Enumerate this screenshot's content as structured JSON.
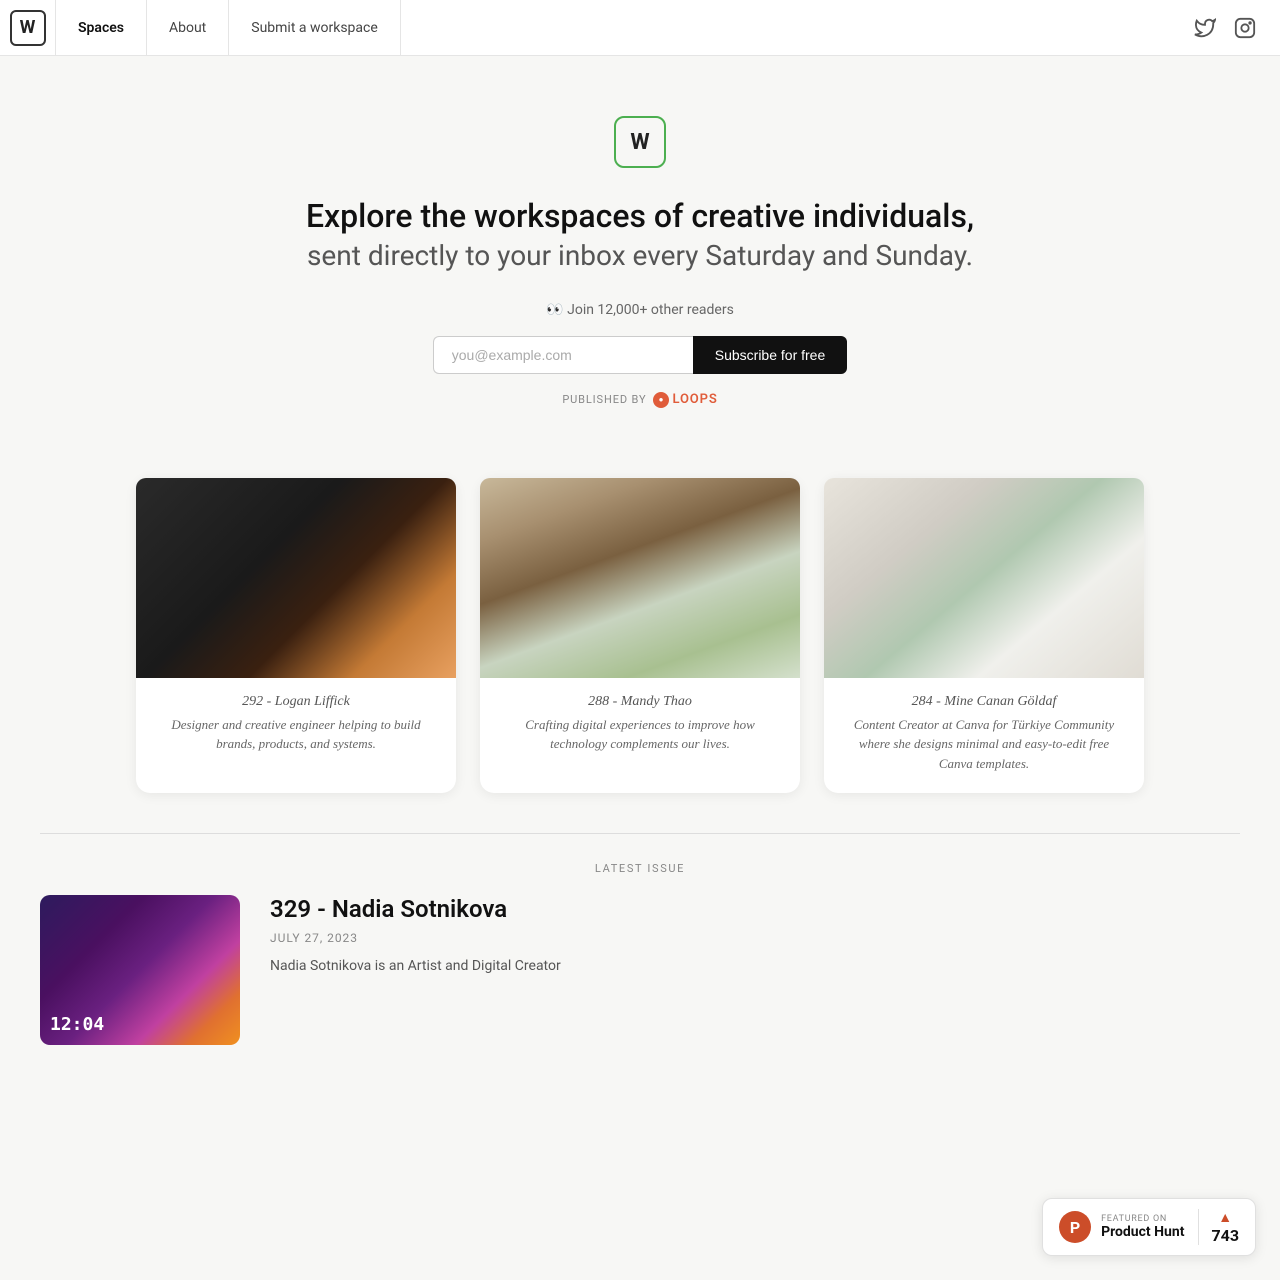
{
  "nav": {
    "logo_letter": "W",
    "links": [
      {
        "id": "spaces",
        "label": "Spaces",
        "active": true
      },
      {
        "id": "about",
        "label": "About",
        "active": false
      },
      {
        "id": "submit",
        "label": "Submit a workspace",
        "active": false
      }
    ]
  },
  "hero": {
    "logo_letter": "W",
    "title": "Explore the workspaces of creative individuals,",
    "subtitle": "sent directly to your inbox every Saturday and Sunday.",
    "readers_text": "👀 Join 12,000+ other readers",
    "email_placeholder": "you@example.com",
    "subscribe_label": "Subscribe for free",
    "published_prefix": "PUBLISHED BY",
    "loops_label": "Loops"
  },
  "cards": [
    {
      "id": "card-1",
      "number": "292 - Logan Liffick",
      "description": "Designer and creative engineer helping to build brands, products, and systems.",
      "img_class": "card-img-1"
    },
    {
      "id": "card-2",
      "number": "288 - Mandy Thao",
      "description": "Crafting digital experiences to improve how technology complements our lives.",
      "img_class": "card-img-2"
    },
    {
      "id": "card-3",
      "number": "284 - Mine Canan Göldaf",
      "description": "Content Creator at Canva for Türkiye Community where she designs minimal and easy-to-edit free Canva templates.",
      "img_class": "card-img-3"
    }
  ],
  "latest_section": {
    "label": "LATEST ISSUE",
    "issue": {
      "title": "329 - Nadia Sotnikova",
      "date": "JULY 27, 2023",
      "description": "Nadia Sotnikova is an Artist and Digital Creator",
      "clock": "12:04"
    }
  },
  "product_hunt": {
    "featured_label": "FEATURED ON",
    "name": "Product Hunt",
    "count": "743"
  }
}
